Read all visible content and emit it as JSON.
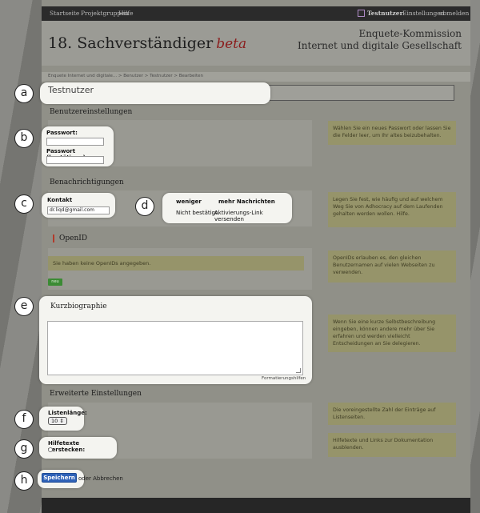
{
  "nav": {
    "home": "Startseite",
    "projects": "Projektgruppen",
    "help": "Hilfe",
    "user": "Testnutzer",
    "settings": "Einstellungen",
    "logout": "abmelden"
  },
  "header": {
    "title": "18. Sachverständiger",
    "beta": "beta",
    "subtitle_line1": "Enquete-Kommission",
    "subtitle_line2": "Internet und digitale Gesellschaft"
  },
  "breadcrumb": "Enquete Internet und digitale... > Benutzer > Testnutzer > Bearbeiten",
  "title_field": {
    "value": "Testnutzer"
  },
  "callouts": {
    "a": "a",
    "b": "b",
    "c": "c",
    "d": "d",
    "e": "e",
    "f": "f",
    "g": "g",
    "h": "h"
  },
  "sections": {
    "user_settings": "Benutzereinstellungen",
    "notifications": "Benachrichtigungen",
    "openid": "OpenID",
    "bio": "Kurzbiographie",
    "advanced": "Erweiterte Einstellungen"
  },
  "password": {
    "label": "Passwort:",
    "confirm_label": "Passwort (bestätigen):"
  },
  "contact": {
    "label": "Kontakt",
    "email": "dr.liqd@gmail.com"
  },
  "frequency": {
    "less": "weniger",
    "more": "mehr Nachrichten",
    "not_confirmed": "Nicht bestätigt",
    "activation_link": "Aktivierungs-Link versenden"
  },
  "openid": {
    "none_text": "Sie haben keine OpenIDs angegeben.",
    "new_button": "neu"
  },
  "bio": {
    "format_help": "Formatierungshilfen"
  },
  "advanced": {
    "list_length_label": "Listenlänge:",
    "list_length_value": "10",
    "hide_help_label": "Hilfetexte verstecken:"
  },
  "actions": {
    "save": "Speichern",
    "or_cancel": "oder Abbrechen"
  },
  "help": {
    "password": "Wählen Sie ein neues Passwort oder lassen Sie die Felder leer, um Ihr altes beizubehalten.",
    "notifications": "Legen Sie fest, wie häufig und auf welchem Weg Sie von Adhocracy auf dem Laufenden gehalten werden wollen. Hilfe.",
    "openid": "OpenIDs erlauben es, den gleichen Benutzernamen auf vielen Webseiten zu verwenden.",
    "bio": "Wenn Sie eine kurze Selbstbeschreibung eingeben, können andere mehr über Sie erfahren und werden vielleicht Entscheidungen an Sie delegieren.",
    "list_length": "Die voreingestellte Zahl der Einträge auf Listenseiten.",
    "hide_help": "Hilfetexte und Links zur Dokumentation ausblenden."
  },
  "colors": {
    "accent_red": "#8b1c1c",
    "save_blue": "#2f62b7",
    "new_green": "#3b8b34",
    "help_box": "#96946a"
  }
}
